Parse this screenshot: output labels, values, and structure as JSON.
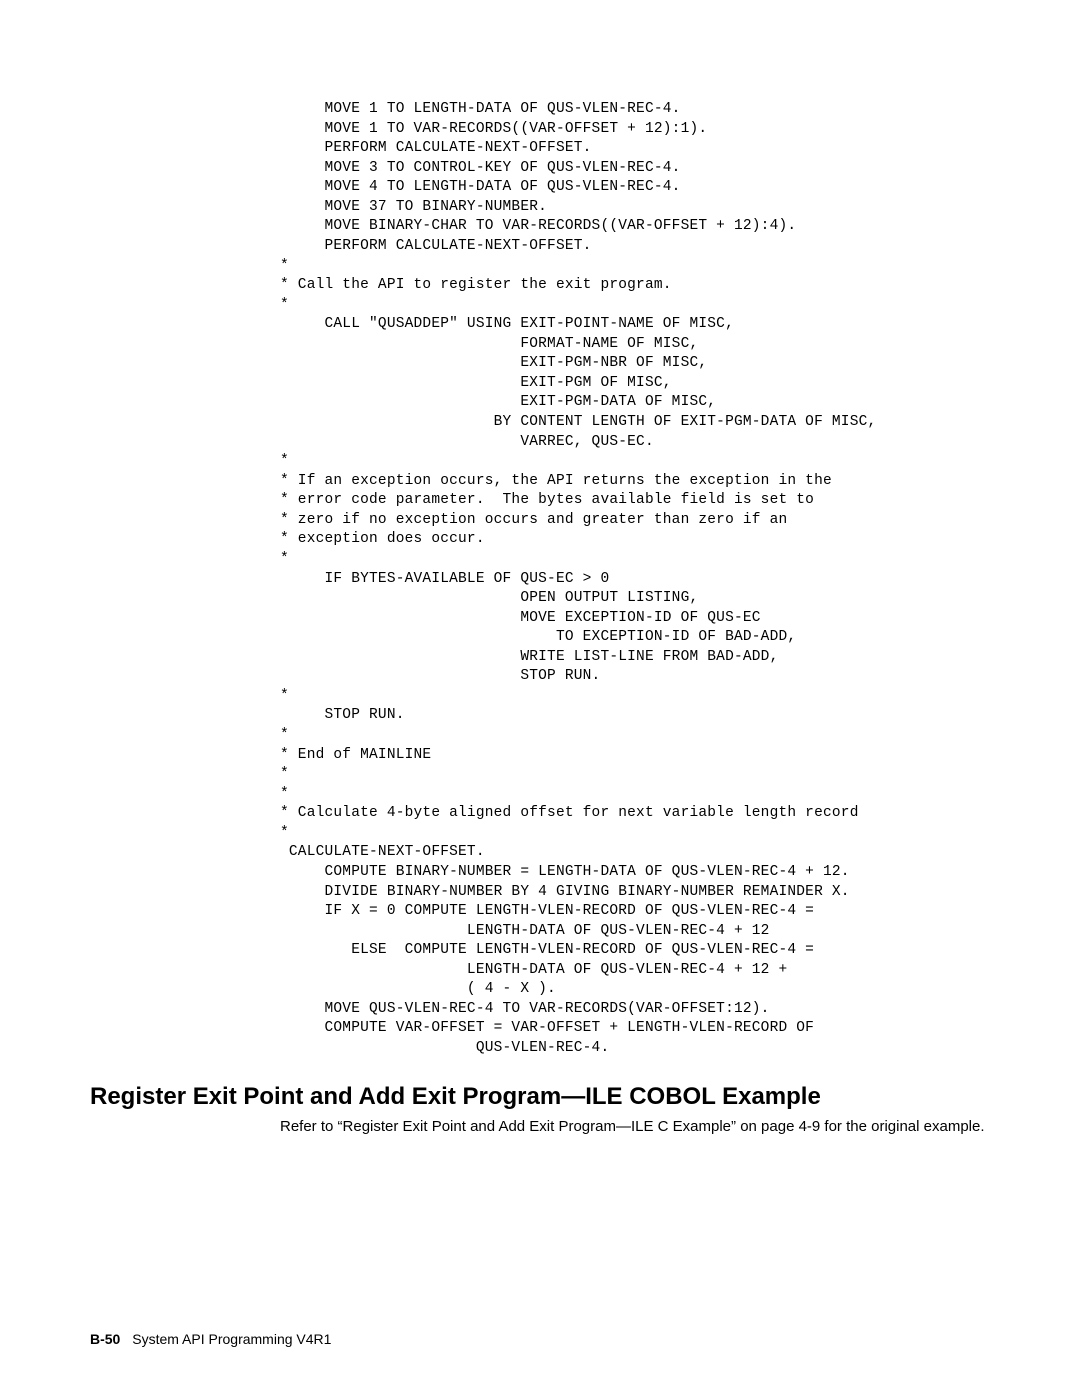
{
  "code": "     MOVE 1 TO LENGTH-DATA OF QUS-VLEN-REC-4.\n     MOVE 1 TO VAR-RECORDS((VAR-OFFSET + 12):1).\n     PERFORM CALCULATE-NEXT-OFFSET.\n     MOVE 3 TO CONTROL-KEY OF QUS-VLEN-REC-4.\n     MOVE 4 TO LENGTH-DATA OF QUS-VLEN-REC-4.\n     MOVE 37 TO BINARY-NUMBER.\n     MOVE BINARY-CHAR TO VAR-RECORDS((VAR-OFFSET + 12):4).\n     PERFORM CALCULATE-NEXT-OFFSET.\n*\n* Call the API to register the exit program.\n*\n     CALL \"QUSADDEP\" USING EXIT-POINT-NAME OF MISC,\n                           FORMAT-NAME OF MISC,\n                           EXIT-PGM-NBR OF MISC,\n                           EXIT-PGM OF MISC,\n                           EXIT-PGM-DATA OF MISC,\n                        BY CONTENT LENGTH OF EXIT-PGM-DATA OF MISC,\n                           VARREC, QUS-EC.\n*\n* If an exception occurs, the API returns the exception in the\n* error code parameter.  The bytes available field is set to\n* zero if no exception occurs and greater than zero if an\n* exception does occur.\n*\n     IF BYTES-AVAILABLE OF QUS-EC > 0\n                           OPEN OUTPUT LISTING,\n                           MOVE EXCEPTION-ID OF QUS-EC\n                               TO EXCEPTION-ID OF BAD-ADD,\n                           WRITE LIST-LINE FROM BAD-ADD,\n                           STOP RUN.\n*\n     STOP RUN.\n*\n* End of MAINLINE\n*\n*\n* Calculate 4-byte aligned offset for next variable length record\n*\n CALCULATE-NEXT-OFFSET.\n     COMPUTE BINARY-NUMBER = LENGTH-DATA OF QUS-VLEN-REC-4 + 12.\n     DIVIDE BINARY-NUMBER BY 4 GIVING BINARY-NUMBER REMAINDER X.\n     IF X = 0 COMPUTE LENGTH-VLEN-RECORD OF QUS-VLEN-REC-4 =\n                     LENGTH-DATA OF QUS-VLEN-REC-4 + 12\n        ELSE  COMPUTE LENGTH-VLEN-RECORD OF QUS-VLEN-REC-4 =\n                     LENGTH-DATA OF QUS-VLEN-REC-4 + 12 +\n                     ( 4 - X ).\n     MOVE QUS-VLEN-REC-4 TO VAR-RECORDS(VAR-OFFSET:12).\n     COMPUTE VAR-OFFSET = VAR-OFFSET + LENGTH-VLEN-RECORD OF\n                      QUS-VLEN-REC-4.",
  "heading": "Register Exit Point and Add Exit Program—ILE COBOL Example",
  "body": "Refer to “Register Exit Point and Add Exit Program—ILE C Example” on page 4-9 for the original example.",
  "footer": {
    "page": "B-50",
    "title": "System API Programming V4R1"
  }
}
